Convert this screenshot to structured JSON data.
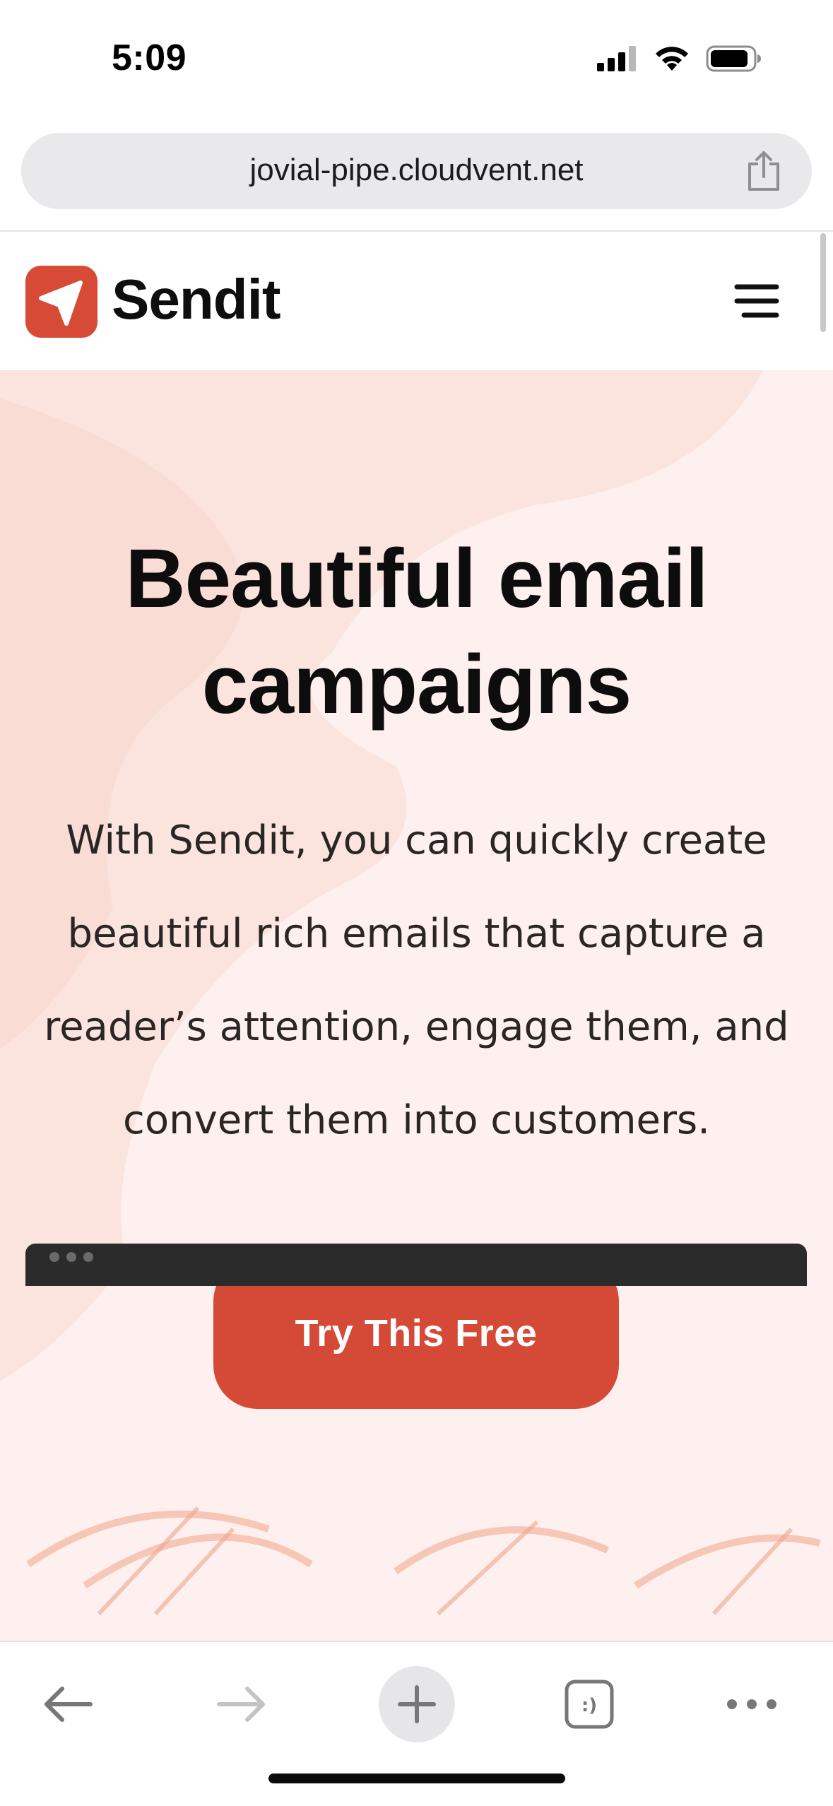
{
  "status_bar": {
    "time": "5:09",
    "signal_icon": "cellular-signal-icon",
    "wifi_icon": "wifi-icon",
    "battery_icon": "battery-icon"
  },
  "browser": {
    "url": "jovial-pipe.cloudvent.net",
    "share_icon": "share-icon",
    "toolbar": {
      "back_icon": "back-arrow-icon",
      "forward_icon": "forward-arrow-icon",
      "new_tab_icon": "plus-icon",
      "tabs_icon": "tabs-icon",
      "tabs_glyph": ":)",
      "more_icon": "more-icon"
    }
  },
  "site": {
    "brand": "Sendit",
    "logo_icon": "paper-plane-icon",
    "menu_icon": "hamburger-menu-icon",
    "hero": {
      "title": "Beautiful email campaigns",
      "description": "With Sendit, you can quickly create beautiful rich emails that capture a reader’s attention, engage them, and convert them into customers.",
      "cta_label": "Try This Free"
    }
  },
  "colors": {
    "brand_red": "#d44a36",
    "hero_background": "#fdf0ee",
    "text_dark": "#0d0d0d"
  }
}
